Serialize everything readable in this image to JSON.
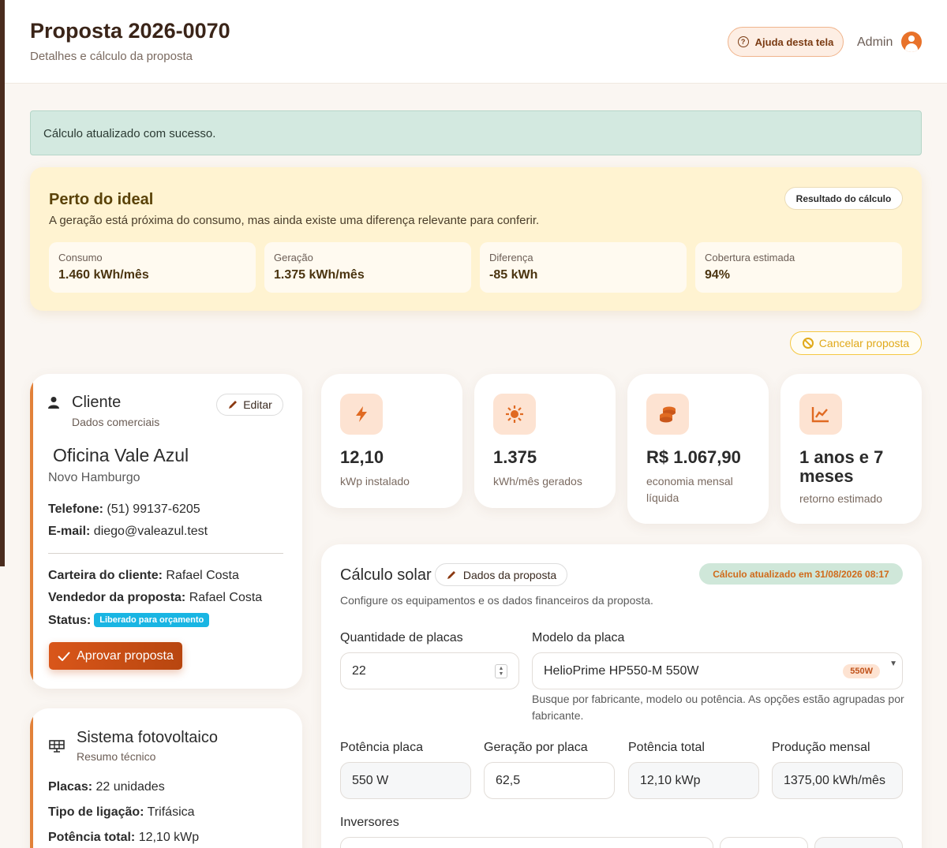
{
  "header": {
    "title": "Proposta 2026-0070",
    "subtitle": "Detalhes e cálculo da proposta",
    "help_label": "Ajuda desta tela",
    "user_label": "Admin"
  },
  "alert": {
    "message": "Cálculo atualizado com sucesso."
  },
  "result": {
    "title": "Perto do ideal",
    "description": "A geração está próxima do consumo, mas ainda existe uma diferença relevante para conferir.",
    "badge": "Resultado do cálculo",
    "metrics": [
      {
        "label": "Consumo",
        "value": "1.460 kWh/mês"
      },
      {
        "label": "Geração",
        "value": "1.375 kWh/mês"
      },
      {
        "label": "Diferença",
        "value": "-85 kWh"
      },
      {
        "label": "Cobertura estimada",
        "value": "94%"
      }
    ]
  },
  "cancel_label": "Cancelar proposta",
  "client": {
    "section_title": "Cliente",
    "section_subtitle": "Dados comerciais",
    "edit_label": "Editar",
    "name": "Oficina Vale Azul",
    "city": "Novo Hamburgo",
    "phone_label": "Telefone:",
    "phone": "(51) 99137-6205",
    "email_label": "E-mail:",
    "email": "diego@valeazul.test",
    "portfolio_label": "Carteira do cliente:",
    "portfolio": "Rafael Costa",
    "seller_label": "Vendedor da proposta:",
    "seller": "Rafael Costa",
    "status_label": "Status:",
    "status": "Liberado para orçamento",
    "approve_label": "Aprovar proposta"
  },
  "system": {
    "section_title": "Sistema fotovoltaico",
    "section_subtitle": "Resumo técnico",
    "panels_label": "Placas:",
    "panels": "22 unidades",
    "connection_label": "Tipo de ligação:",
    "connection": "Trifásica",
    "power_label": "Potência total:",
    "power": "12,10 kWp"
  },
  "kpis": [
    {
      "icon": "lightning-icon",
      "value": "12,10",
      "caption": "kWp instalado"
    },
    {
      "icon": "sun-icon",
      "value": "1.375",
      "caption": "kWh/mês gerados"
    },
    {
      "icon": "coins-icon",
      "value": "R$ 1.067,90",
      "caption": "economia mensal líquida"
    },
    {
      "icon": "chart-line-icon",
      "value": "1 anos e 7 meses",
      "caption": "retorno estimado"
    }
  ],
  "calc": {
    "title": "Cálculo solar",
    "data_btn": "Dados da proposta",
    "updated_badge": "Cálculo atualizado em 31/08/2026 08:17",
    "description": "Configure os equipamentos e os dados financeiros da proposta.",
    "qty_label": "Quantidade de placas",
    "qty_value": "22",
    "model_label": "Modelo da placa",
    "model_value": "HelioPrime HP550-M 550W",
    "model_badge": "550W",
    "model_hint": "Busque por fabricante, modelo ou potência. As opções estão agrupadas por fabricante.",
    "fields": [
      {
        "label": "Potência placa",
        "value": "550 W"
      },
      {
        "label": "Geração por placa",
        "value": "62,5"
      },
      {
        "label": "Potência total",
        "value": "12,10 kWp"
      },
      {
        "label": "Produção mensal",
        "value": "1375,00 kWh/mês"
      }
    ],
    "inverters_label": "Inversores"
  }
}
